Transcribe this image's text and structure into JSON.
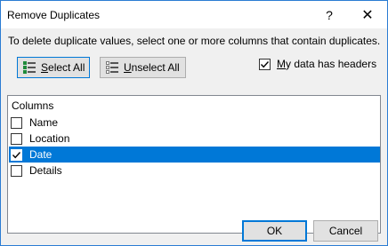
{
  "window": {
    "title": "Remove Duplicates",
    "help_glyph": "?",
    "close_glyph": "✕"
  },
  "instruction": "To delete duplicate values, select one or more columns that contain duplicates.",
  "toolbar": {
    "select_all_prefix": "",
    "select_all_mnemonic": "S",
    "select_all_rest": "elect All",
    "unselect_all_mnemonic": "U",
    "unselect_all_rest": "nselect All"
  },
  "headers_option": {
    "mnemonic": "M",
    "rest": "y data has headers",
    "checked": true
  },
  "columns": {
    "header": "Columns",
    "items": [
      {
        "label": "Name",
        "checked": false,
        "selected": false
      },
      {
        "label": "Location",
        "checked": false,
        "selected": false
      },
      {
        "label": "Date",
        "checked": true,
        "selected": true
      },
      {
        "label": "Details",
        "checked": false,
        "selected": false
      }
    ]
  },
  "footer": {
    "ok_label": "OK",
    "cancel_label": "Cancel"
  },
  "colors": {
    "accent": "#0078d7",
    "dialog_bg": "#f0f0f0",
    "selection": "#0078d7"
  }
}
